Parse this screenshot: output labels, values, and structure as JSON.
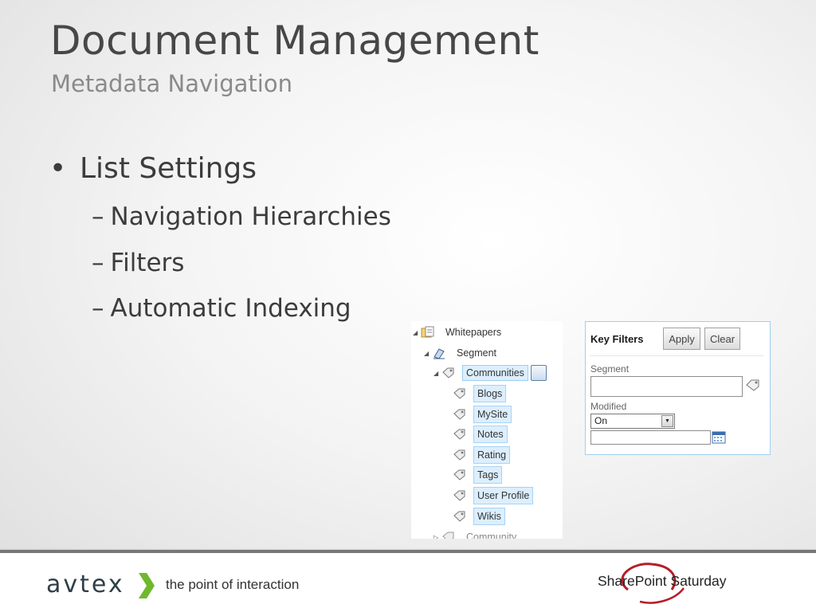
{
  "slide": {
    "title": "Document Management",
    "subtitle": "Metadata Navigation",
    "bullet": "List Settings",
    "bullet_glyph": "•",
    "dash": "–",
    "sub_items": [
      "Navigation Hierarchies",
      "Filters",
      "Automatic Indexing"
    ]
  },
  "tree": {
    "root": "Whitepapers",
    "level1": "Segment",
    "level2": "Communities",
    "children": [
      "Blogs",
      "MySite",
      "Notes",
      "Rating",
      "Tags",
      "User Profile",
      "Wikis"
    ],
    "cut_off_node": "Community"
  },
  "key_filters": {
    "heading": "Key Filters",
    "apply_label": "Apply",
    "clear_label": "Clear",
    "segment_label": "Segment",
    "segment_value": "",
    "modified_label": "Modified",
    "modified_selected": "On",
    "date_value": ""
  },
  "footer": {
    "brand": "avtex",
    "tagline": "the point of interaction",
    "event_logo": "SharePoint Saturday"
  },
  "colors": {
    "highlight_bg": "#dcefff",
    "highlight_border": "#9fcdf0",
    "brand_green": "#6fb82e",
    "logo_red": "#b51d2a"
  }
}
